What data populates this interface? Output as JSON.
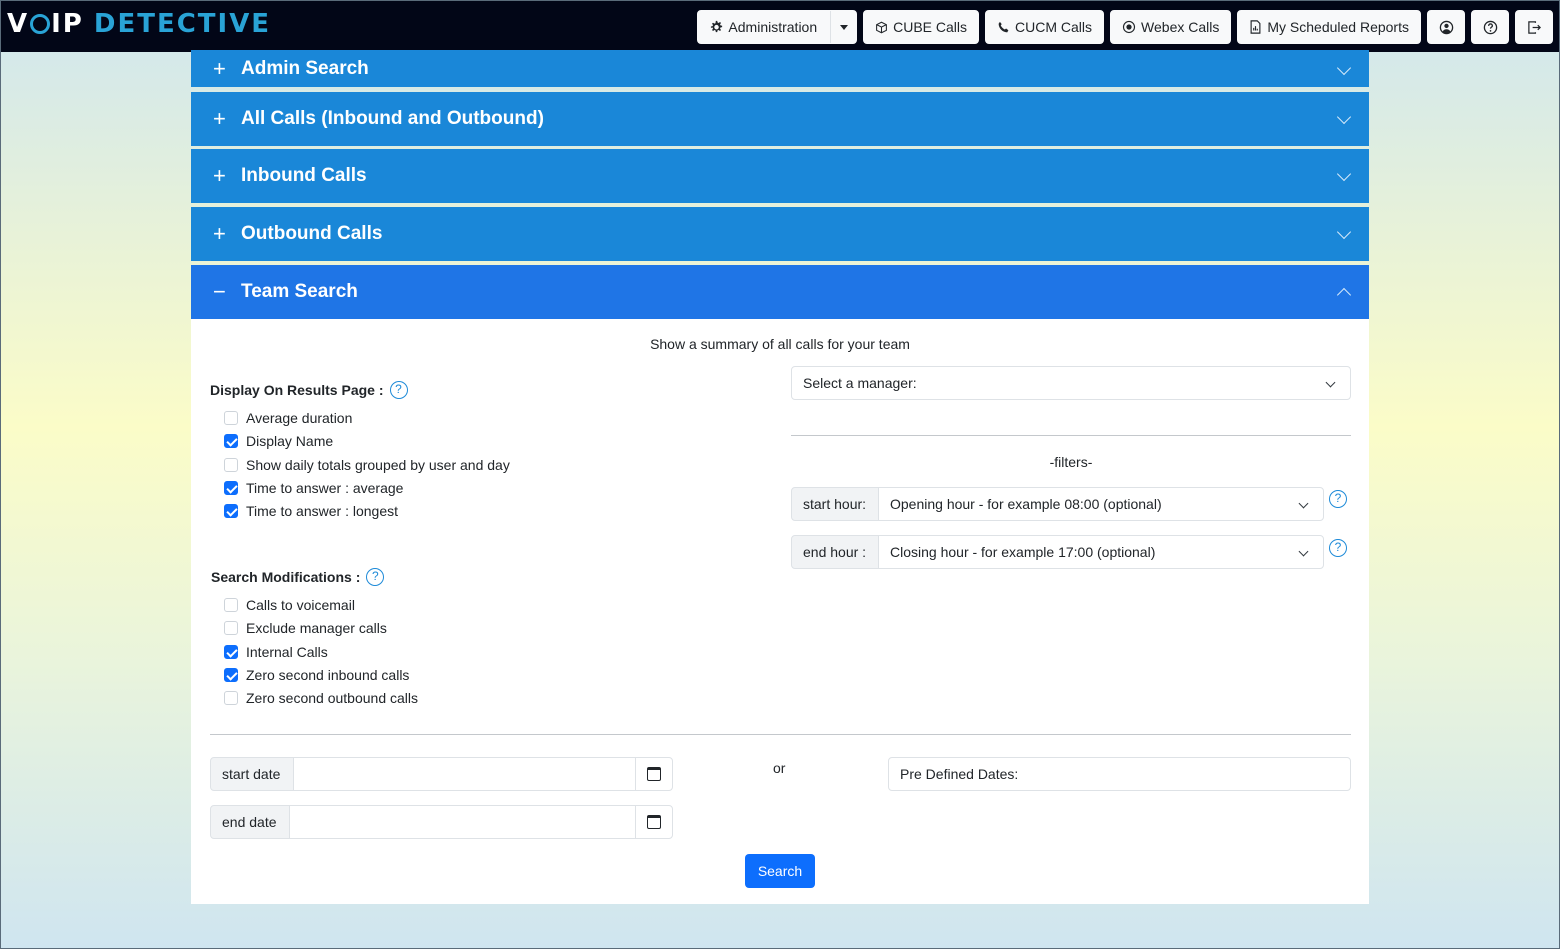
{
  "brand": {
    "part1": "V",
    "part2": "IP",
    "part3": "DETECTIVE"
  },
  "nav": {
    "administration": "Administration",
    "cube_calls": "CUBE Calls",
    "cucm_calls": "CUCM Calls",
    "webex_calls": "Webex Calls",
    "scheduled_reports": "My Scheduled Reports"
  },
  "accordion": {
    "admin_search": "Admin Search",
    "all_calls": "All Calls (Inbound and Outbound)",
    "inbound": "Inbound Calls",
    "outbound": "Outbound Calls",
    "team_search": "Team Search"
  },
  "team": {
    "summary": "Show a summary of all calls for your team",
    "display_title": "Display On Results Page :",
    "display_options": [
      {
        "label": "Average duration",
        "checked": false
      },
      {
        "label": "Display Name",
        "checked": true
      },
      {
        "label": "Show daily totals grouped by user and day",
        "checked": false
      },
      {
        "label": "Time to answer : average",
        "checked": true
      },
      {
        "label": "Time to answer : longest",
        "checked": true
      }
    ],
    "mods_title": "Search Modifications :",
    "mods_options": [
      {
        "label": "Calls to voicemail",
        "checked": false
      },
      {
        "label": "Exclude manager calls",
        "checked": false
      },
      {
        "label": "Internal Calls",
        "checked": true
      },
      {
        "label": "Zero second inbound calls",
        "checked": true
      },
      {
        "label": "Zero second outbound calls",
        "checked": false
      }
    ],
    "manager_select": "Select a manager:",
    "filters_label": "-filters-",
    "start_hour_label": "start hour:",
    "start_hour_value": "Opening hour - for example 08:00 (optional)",
    "end_hour_label": "end hour :",
    "end_hour_value": "Closing hour - for example 17:00 (optional)",
    "start_date_label": "start date",
    "end_date_label": "end date",
    "or_label": "or",
    "predefined_dates": "Pre Defined Dates:",
    "search_button": "Search"
  },
  "help_glyph": "?",
  "colors": {
    "accordion": "#1a87d8",
    "accordion_active": "#1f75e6",
    "primary": "#0d6efd",
    "navbar": "#020617"
  }
}
